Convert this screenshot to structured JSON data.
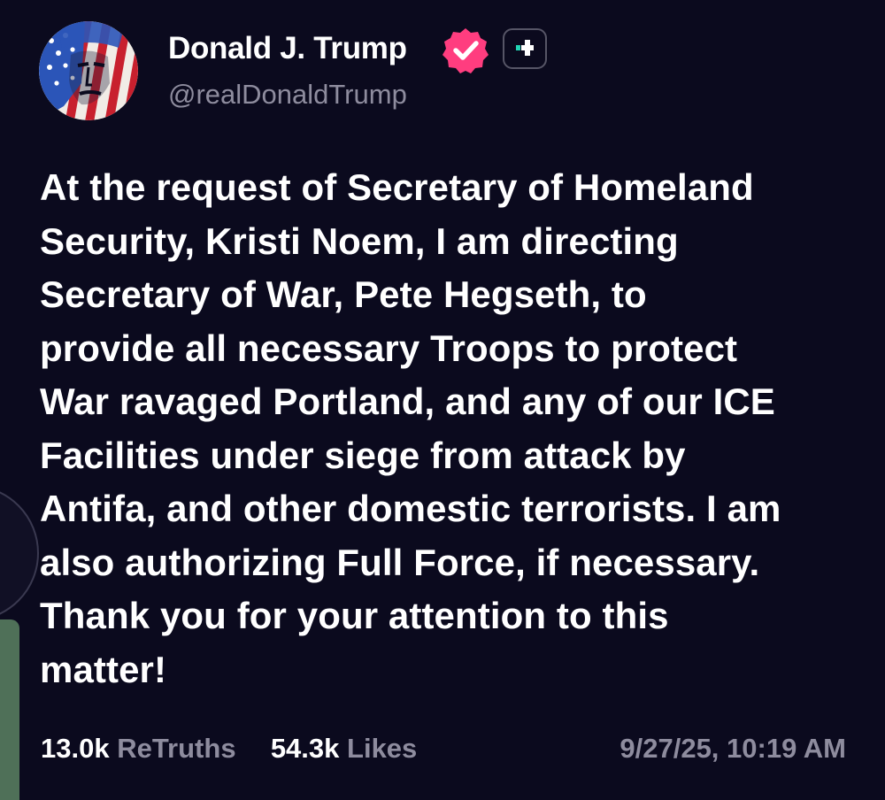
{
  "profile": {
    "display_name": "Donald J. Trump",
    "handle": "@realDonaldTrump",
    "avatar_icon": "flag-painted-face-avatar",
    "verified_icon": "verified-badge-icon",
    "verified_color": "#ff3d7f",
    "plus_icon": "truth-plus-icon",
    "plus_accent": "#21d4b4"
  },
  "post": {
    "lines": [
      "At the request of Secretary of Homeland",
      "Security, Kristi Noem, I am directing",
      "Secretary of War, Pete Hegseth, to",
      "provide all necessary Troops to protect",
      "War ravaged Portland, and any of our ICE",
      "Facilities under siege from attack by",
      "Antifa, and other domestic terrorists. I am",
      "also authorizing Full Force, if necessary.",
      "Thank you for your attention to this",
      "matter!"
    ]
  },
  "stats": {
    "retruths_count": "13.0k",
    "retruths_label": "ReTruths",
    "likes_count": "54.3k",
    "likes_label": "Likes"
  },
  "timestamp": "9/27/25, 10:19 AM",
  "colors": {
    "background": "#0b0a1e",
    "text": "#ffffff",
    "muted": "#8e8c9e",
    "side_bar": "#4f7058"
  }
}
